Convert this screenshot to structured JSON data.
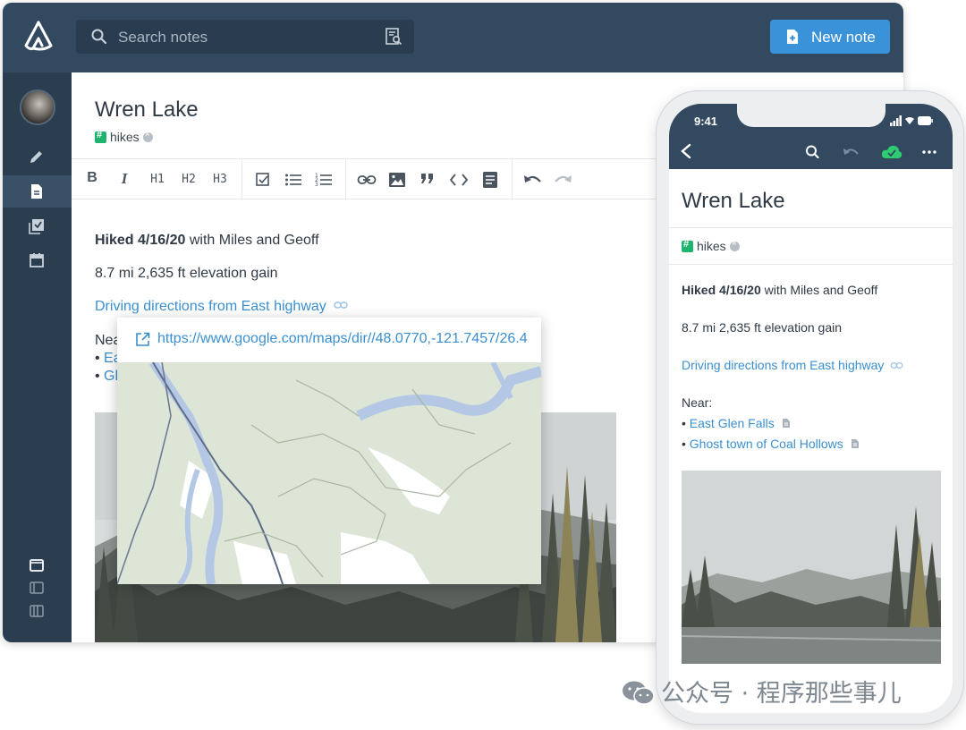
{
  "desktop": {
    "search": {
      "placeholder": "Search notes"
    },
    "new_note_label": "New note",
    "note": {
      "title": "Wren Lake",
      "tag": "hikes",
      "line1_bold": "Hiked 4/16/20",
      "line1_rest": " with Miles and Geoff",
      "line2": "8.7 mi 2,635 ft elevation gain",
      "link": "Driving directions from East highway",
      "near_partial": "Nea",
      "bullet1_partial": "Ea",
      "bullet2_partial": "Gh"
    },
    "toolbar": {
      "bold": "B",
      "italic": "I",
      "h1": "H1",
      "h2": "H2",
      "h3": "H3"
    },
    "link_popup": {
      "url": "https://www.google.com/maps/dir//48.0770,-121.7457/26.4"
    }
  },
  "phone": {
    "time": "9:41",
    "title": "Wren Lake",
    "tag": "hikes",
    "line1_bold": "Hiked 4/16/20",
    "line1_rest": " with Miles and Geoff",
    "line2": "8.7 mi 2,635 ft elevation gain",
    "link": "Driving directions from East highway",
    "near_label": "Near:",
    "near_items": [
      "East Glen Falls",
      "Ghost town of Coal Hollows"
    ]
  },
  "watermark": "公众号 · 程序那些事儿",
  "colors": {
    "header": "#33495f",
    "sidebar": "#2b3e50",
    "accent": "#3a93d8",
    "link": "#3a8fd0",
    "tag": "#1eb36f",
    "sync": "#2ecc71"
  }
}
